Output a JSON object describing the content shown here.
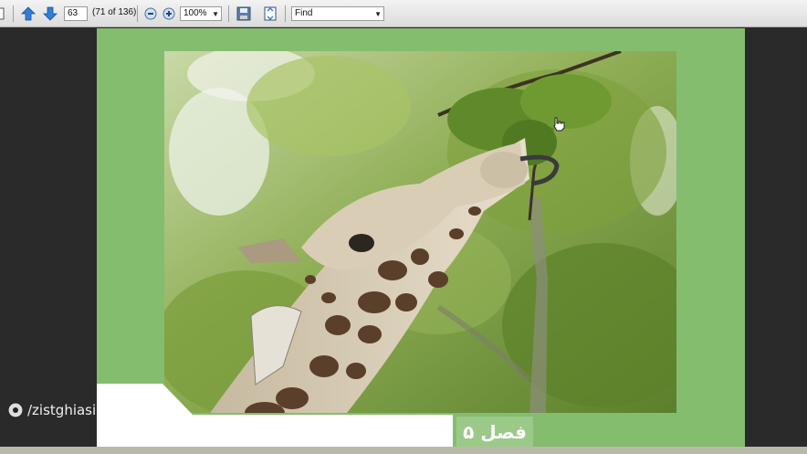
{
  "toolbar": {
    "page_number": "63",
    "page_count_label": "(71 of 136)",
    "zoom": "100%",
    "find_placeholder": "Find",
    "icons": [
      "prev-page-icon",
      "next-page-icon",
      "zoom-out-icon",
      "zoom-in-icon",
      "save-icon",
      "fit-page-icon"
    ]
  },
  "document": {
    "chapter_label": "فصل ۵",
    "page_color": "#84bd6e"
  },
  "watermark": {
    "text": "/zistghiasi"
  }
}
